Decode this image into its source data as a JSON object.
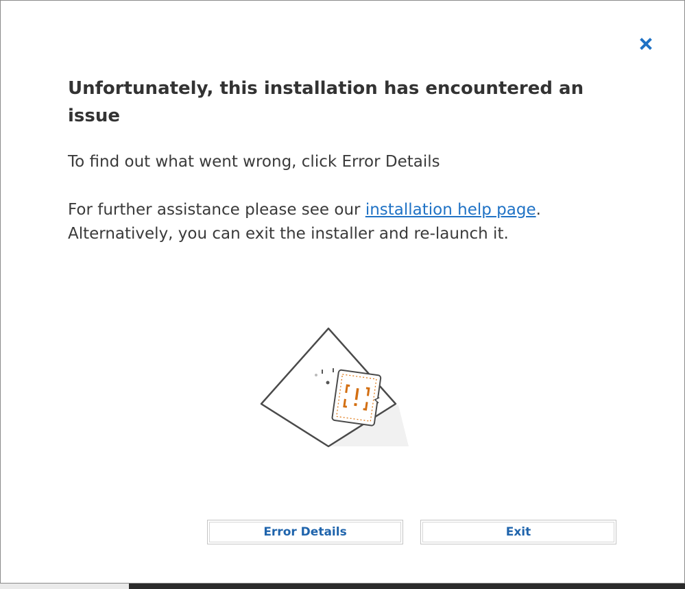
{
  "dialog": {
    "heading": "Unfortunately, this installation has encountered an issue",
    "line1": "To find out what went wrong, click Error Details",
    "line2_before": "For further assistance please see our ",
    "help_link": "installation help page",
    "line2_after": ".",
    "line3": "Alternatively, you can exit the installer and re-launch it.",
    "close_icon": "close-icon",
    "illustration_icon": "warning-card-illustration"
  },
  "buttons": {
    "error_details": "Error Details",
    "exit": "Exit"
  },
  "colors": {
    "accent": "#1f72c5",
    "button_text": "#1f64ac",
    "warning": "#e07b1a",
    "heading": "#333333"
  }
}
